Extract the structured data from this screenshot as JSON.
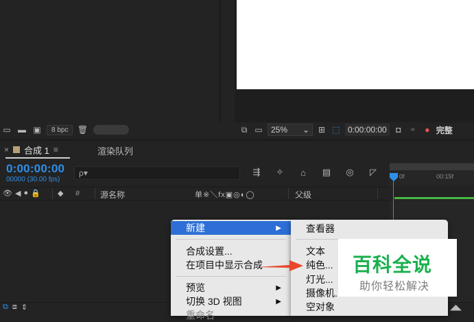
{
  "project": {
    "bpc": "8 bpc"
  },
  "viewer": {
    "zoom": "25%",
    "timecode": "0:00:00:00",
    "quality": "完整"
  },
  "timeline": {
    "tabs": [
      {
        "label": "合成 1",
        "active": true
      },
      {
        "label": "渲染队列",
        "active": false
      }
    ],
    "timecode": "0:00:00:00",
    "timecode_sub": "00000 (30.00 fps)",
    "search_placeholder": "ρ▾",
    "ruler_ticks": [
      "0f",
      "00:15f"
    ],
    "columns": {
      "num": "#",
      "source_name": "源名称",
      "switches": "单※＼fx▣◎◐◯",
      "parent": "父级"
    }
  },
  "context_menu": {
    "items": [
      {
        "label": "新建",
        "selected": true,
        "has_submenu": true
      },
      {
        "label": "合成设置...",
        "selected": false,
        "has_submenu": false
      },
      {
        "label": "在项目中显示合成",
        "selected": false,
        "has_submenu": false
      },
      {
        "label": "预览",
        "selected": false,
        "has_submenu": true
      },
      {
        "label": "切换 3D 视图",
        "selected": false,
        "has_submenu": true
      },
      {
        "label": "重命名",
        "selected": false,
        "has_submenu": false
      }
    ],
    "arrow": "▶"
  },
  "submenu": {
    "items": [
      "查看器",
      "文本",
      "纯色...",
      "灯光...",
      "摄像机...",
      "空对象"
    ]
  },
  "watermark": {
    "title": "百科全说",
    "subtitle": "助你轻松解决"
  },
  "colors": {
    "accent_blue": "#2f8fe8",
    "menu_highlight": "#2d6fd6",
    "watermark_green": "#19b04d",
    "arrow_red": "#e8472c",
    "green_bar": "#49b842"
  }
}
